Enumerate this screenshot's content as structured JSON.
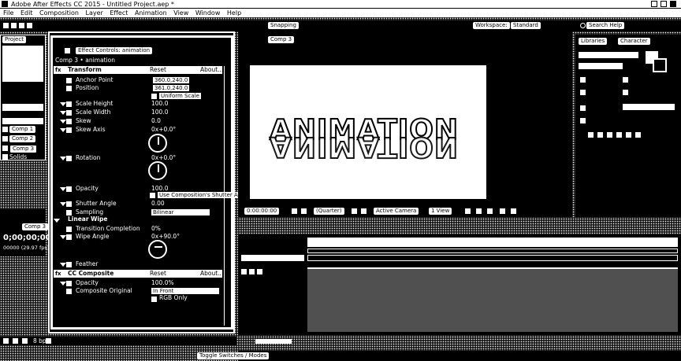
{
  "window": {
    "title": "Adobe After Effects CC 2015 - Untitled Project.aep *",
    "controls": [
      "minimize",
      "maximize",
      "close"
    ]
  },
  "menu": [
    "File",
    "Edit",
    "Composition",
    "Layer",
    "Effect",
    "Animation",
    "View",
    "Window",
    "Help"
  ],
  "toolbar": {
    "snapping": "Snapping",
    "workspace_label": "Workspace:",
    "workspace_value": "Standard",
    "search_help": "Search Help"
  },
  "project_panel": {
    "tab": "Project",
    "items": [
      "Comp 1",
      "Comp 2",
      "Comp 3",
      "Solids"
    ]
  },
  "effect_controls": {
    "tab": "Effect Controls: animation",
    "layer_path": "Comp 3 • animation",
    "transform": {
      "name": "Transform",
      "reset": "Reset",
      "about": "About...",
      "props": [
        {
          "name": "Anchor Point",
          "value": "360.0,240.0"
        },
        {
          "name": "Position",
          "value": "361.0,240.0"
        },
        {
          "name": "",
          "value": "Uniform Scale"
        },
        {
          "name": "Scale Height",
          "value": "100.0"
        },
        {
          "name": "Scale Width",
          "value": "100.0"
        },
        {
          "name": "Skew",
          "value": "0.0"
        },
        {
          "name": "Skew Axis",
          "value": "0x+0.0°"
        },
        {
          "name": "Rotation",
          "value": "0x+0.0°"
        },
        {
          "name": "Opacity",
          "value": "100.0"
        },
        {
          "name": "",
          "value": "Use Composition's Shutter Angle"
        },
        {
          "name": "Shutter Angle",
          "value": "0.00"
        },
        {
          "name": "Sampling",
          "value": "Bilinear"
        }
      ]
    },
    "linear_wipe": {
      "name": "Linear Wipe",
      "props": [
        {
          "name": "Transition Completion",
          "value": "0%"
        },
        {
          "name": "Wipe Angle",
          "value": "0x+90.0°"
        },
        {
          "name": "Feather",
          "value": "0.0"
        }
      ]
    },
    "cc_composite": {
      "name": "CC Composite",
      "reset": "Reset",
      "about": "About...",
      "props": [
        {
          "name": "Opacity",
          "value": "100.0%"
        },
        {
          "name": "Composite Original",
          "value": "In Front"
        },
        {
          "name": "",
          "value": "RGB Only"
        }
      ]
    }
  },
  "composition_panel": {
    "tab": "Comp 3",
    "viewer_text": "ANIMATION",
    "timecode": "0:00:00:00",
    "resolution": "(Quarter)",
    "camera": "Active Camera",
    "views": "1 View"
  },
  "right_panel": {
    "tabs": [
      "Libraries",
      "Character"
    ]
  },
  "timeline": {
    "timecode": "0;00;00;00",
    "fps": "00000 (29.97 fps)",
    "comp_tab": "Comp 3",
    "toggle": "Toggle Switches / Modes"
  },
  "bottom_bar": {
    "bpc": "8 bpc"
  }
}
